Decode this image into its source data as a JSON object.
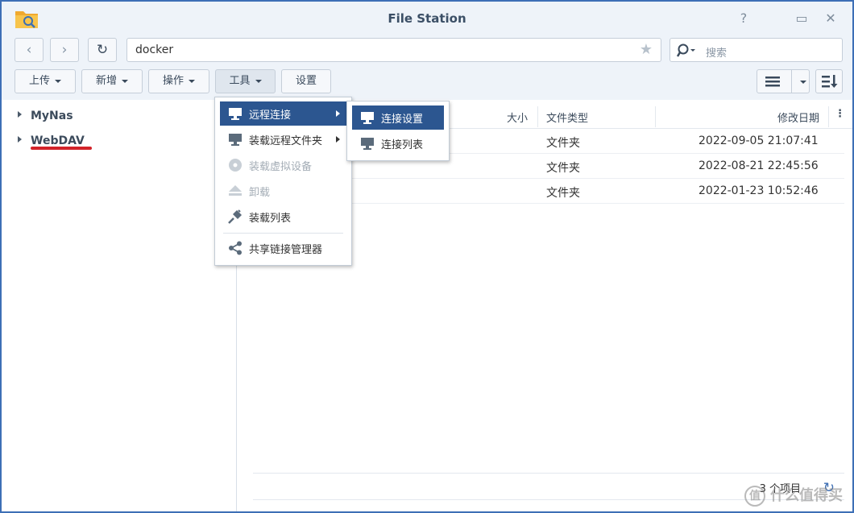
{
  "window": {
    "title": "File Station",
    "help_glyph": "?",
    "minimize_glyph": "▭",
    "close_glyph": "✕"
  },
  "nav": {
    "back_glyph": "‹",
    "forward_glyph": "›",
    "refresh_glyph": "↻",
    "path": "docker",
    "star_glyph": "★",
    "search_placeholder": "搜索"
  },
  "toolbar": {
    "upload": "上传",
    "create": "新增",
    "action": "操作",
    "tools": "工具",
    "settings": "设置"
  },
  "tree": {
    "items": [
      {
        "label": "MyNas"
      },
      {
        "label": "WebDAV"
      }
    ]
  },
  "list": {
    "headers": {
      "size": "大小",
      "type": "文件类型",
      "modified": "修改日期"
    },
    "rows": [
      {
        "type": "文件夹",
        "modified": "2022-09-05 21:07:41"
      },
      {
        "type": "文件夹",
        "modified": "2022-08-21 22:45:56"
      },
      {
        "type": "文件夹",
        "modified": "2022-01-23 10:52:46"
      }
    ],
    "count_text": "3 个项目"
  },
  "tools_menu": {
    "items": [
      {
        "label": "远程连接"
      },
      {
        "label": "装载远程文件夹"
      },
      {
        "label": "装载虚拟设备"
      },
      {
        "label": "卸载"
      },
      {
        "label": "装载列表"
      },
      {
        "label": "共享链接管理器"
      }
    ]
  },
  "remote_submenu": {
    "items": [
      {
        "label": "连接设置"
      },
      {
        "label": "连接列表"
      }
    ]
  },
  "watermark": {
    "glyph": "值",
    "text": "什么值得买"
  },
  "colors": {
    "accent": "#2c5690",
    "window_border": "#3d6fb6",
    "underline": "#d2232a"
  }
}
